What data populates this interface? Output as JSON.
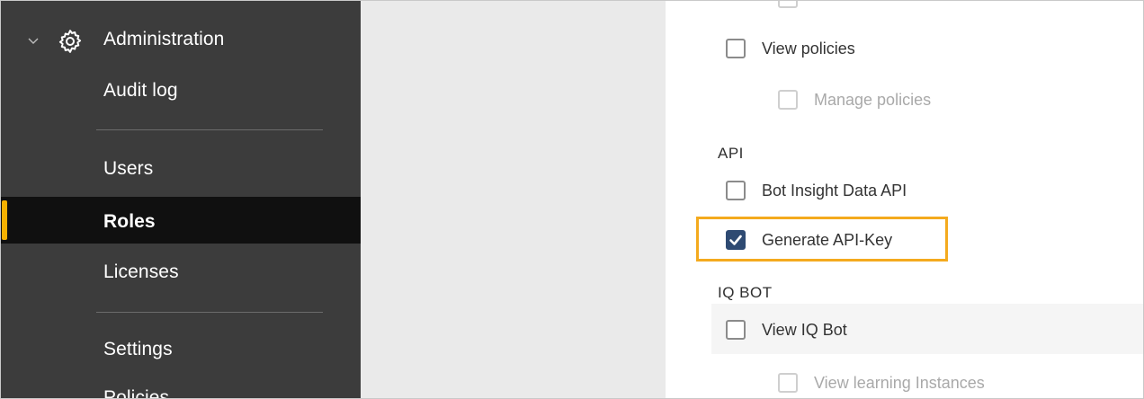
{
  "sidebar": {
    "section_label": "Administration",
    "items": [
      {
        "label": "Audit log",
        "active": false
      },
      {
        "label": "Users",
        "active": false
      },
      {
        "label": "Roles",
        "active": true
      },
      {
        "label": "Licenses",
        "active": false
      },
      {
        "label": "Settings",
        "active": false
      },
      {
        "label": "Policies",
        "active": false
      }
    ],
    "accent_color": "#f6b100"
  },
  "permissions": {
    "view_policies": {
      "label": "View policies",
      "checked": false
    },
    "manage_policies": {
      "label": "Manage policies",
      "checked": false,
      "disabled": true
    },
    "api_section": "API",
    "bot_insight_data_api": {
      "label": "Bot Insight Data API",
      "checked": false
    },
    "generate_api_key": {
      "label": "Generate API-Key",
      "checked": true,
      "highlighted": true
    },
    "iq_bot_section": "IQ BOT",
    "view_iq_bot": {
      "label": "View IQ Bot",
      "checked": false
    },
    "view_learning_instances": {
      "label": "View learning Instances",
      "checked": false,
      "disabled": true
    }
  },
  "colors": {
    "highlight_border": "#f4aa1e",
    "checkbox_checked": "#2e4a72",
    "sidebar_bg": "#3c3c3c"
  }
}
